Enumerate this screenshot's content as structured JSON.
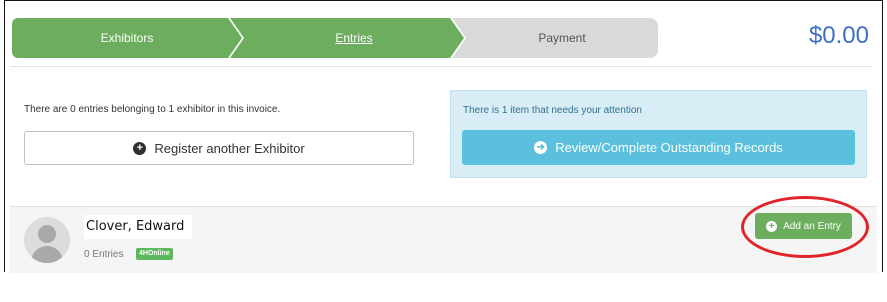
{
  "steps": [
    {
      "label": "Exhibitors",
      "state": "complete"
    },
    {
      "label": "Entries",
      "state": "current"
    },
    {
      "label": "Payment",
      "state": "upcoming"
    }
  ],
  "invoice_total": "$0.00",
  "entries_summary": "There are 0 entries belonging to 1 exhibitor in this invoice.",
  "register_button_label": "Register another Exhibitor",
  "attention": {
    "message": "There is 1 item that needs your attention",
    "button_label": "Review/Complete Outstanding Records"
  },
  "exhibitor": {
    "name": "Clover, Edward",
    "entries": "0 Entries",
    "badge": "4HOnline",
    "add_entry_label": "Add an Entry"
  },
  "colors": {
    "step_active": "#6cae5d",
    "step_inactive": "#d9d9d9",
    "total": "#3f6fc5",
    "info_button": "#5bc0de",
    "highlight": "#e0242a"
  },
  "icons": {
    "register": "plus-circle-icon",
    "review": "arrow-right-circle-icon",
    "add_entry": "plus-circle-icon",
    "avatar": "user-avatar-icon"
  }
}
